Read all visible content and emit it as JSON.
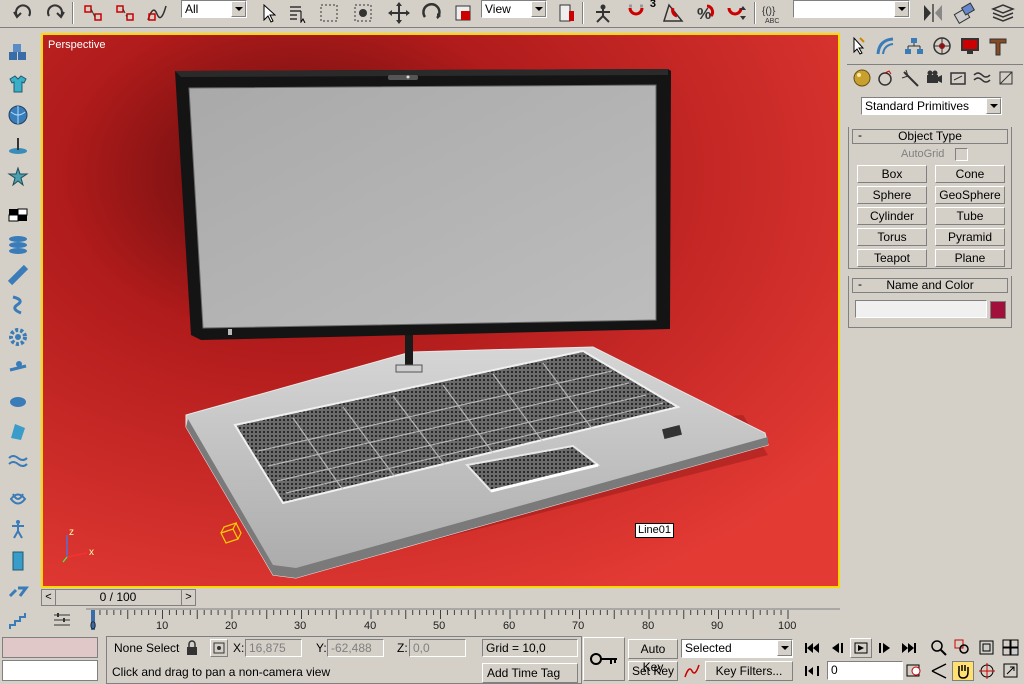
{
  "toolbar": {
    "selection_filter": "All",
    "ref_coord": "View",
    "named_sets": "",
    "angle_snap_superscript": "3"
  },
  "viewport": {
    "label": "Perspective",
    "object_tag": "Line01",
    "axis_labels": {
      "z": "z",
      "x": "x"
    },
    "background_color": "#c42020"
  },
  "command_panel": {
    "category_dropdown": "Standard Primitives",
    "object_type": {
      "title": "Object Type",
      "minus": "-",
      "autogrid_label": "AutoGrid",
      "buttons": [
        "Box",
        "Cone",
        "Sphere",
        "GeoSphere",
        "Cylinder",
        "Tube",
        "Torus",
        "Pyramid",
        "Teapot",
        "Plane"
      ]
    },
    "name_and_color": {
      "title": "Name and Color",
      "minus": "-",
      "name_value": "",
      "color": "#a0103a"
    }
  },
  "timeline": {
    "frame_display": "0 / 100",
    "prev_arrow": "<",
    "next_arrow": ">",
    "ruler_labels": [
      "0",
      "10",
      "20",
      "30",
      "40",
      "50",
      "60",
      "70",
      "80",
      "90",
      "100"
    ]
  },
  "status": {
    "selection": "None Selecte",
    "x_label": "X:",
    "x_value": "16,875",
    "y_label": "Y:",
    "y_value": "-62,488",
    "z_label": "Z:",
    "z_value": "0,0",
    "grid": "Grid = 10,0",
    "prompt": "Click and drag to pan a non-camera view",
    "add_time_tag": "Add Time Tag"
  },
  "animation": {
    "auto_key": "Auto Key",
    "set_key": "Set Key",
    "key_mode": "Selected",
    "key_filters": "Key Filters...",
    "current_frame": "0"
  },
  "colors": {
    "accent_yellow": "#ffd800",
    "ui_gray": "#d4d0c8"
  }
}
